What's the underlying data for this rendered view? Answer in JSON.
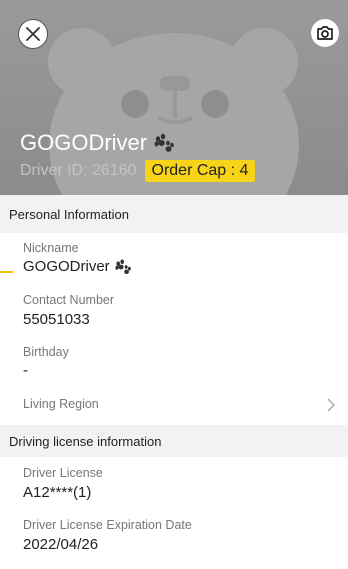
{
  "header": {
    "driver_name": "GOGODriver",
    "driver_id": "Driver ID: 26160",
    "order_cap": "Order Cap : 4"
  },
  "personal_section": {
    "title": "Personal Information",
    "nickname_label": "Nickname",
    "nickname_value": "GOGODriver",
    "contact_label": "Contact Number",
    "contact_value": "55051033",
    "birthday_label": "Birthday",
    "birthday_value": "-",
    "region_label": "Living Region"
  },
  "license_section": {
    "title": "Driving license information",
    "license_label": "Driver License",
    "license_value": "A12****(1)",
    "expiry_label": "Driver License Expiration Date",
    "expiry_value": "2022/04/26"
  },
  "colors": {
    "badge": "#f7d417",
    "header_bg": "#909090",
    "section_bg": "#f2f2f2"
  },
  "icons": [
    "close-icon",
    "camera-icon",
    "paw-icon",
    "chevron-right-icon",
    "bear-placeholder-icon"
  ]
}
